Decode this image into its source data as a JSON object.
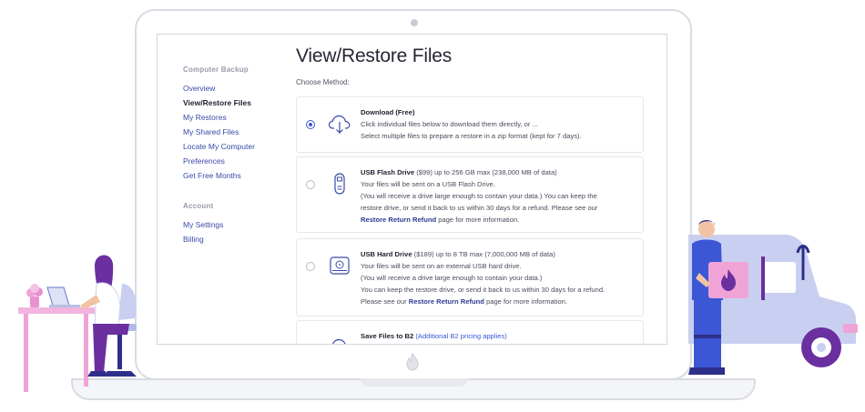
{
  "sidebar": {
    "section_backup": "Computer Backup",
    "backup_items": [
      "Overview",
      "View/Restore Files",
      "My Restores",
      "My Shared Files",
      "Locate My Computer",
      "Preferences",
      "Get Free Months"
    ],
    "active_index": 1,
    "section_account": "Account",
    "account_items": [
      "My Settings",
      "Billing"
    ]
  },
  "main": {
    "title": "View/Restore Files",
    "choose_label": "Choose Method:"
  },
  "methods": {
    "download": {
      "icon": "cloud-download-icon",
      "title": "Download (Free)",
      "line1": "Click individual files below to download them directly, or ...",
      "line2": "Select multiple files to prepare a restore in a zip format (kept for 7 days)."
    },
    "usb_flash": {
      "icon": "usb-flash-drive-icon",
      "title": "USB Flash Drive",
      "price": " ($99) up to 256 GB max (238,000 MB of data)",
      "line1": "Your files will be sent on a USB Flash Drive.",
      "line2": "(You will receive a drive large enough to contain your data.) You can keep the",
      "line3": "restore drive, or send it back to us within 30 days for a refund. Please see our",
      "link": "Restore Return Refund",
      "after_link": " page for more information."
    },
    "usb_hdd": {
      "icon": "hard-drive-icon",
      "title": "USB Hard Drive",
      "price": " ($189) up to 8 TB max (7,000,000 MB of data)",
      "line1": "Your files will be sent on an external USB hard drive.",
      "line2": "(You will receive a drive large enough to contain your data.)",
      "line3": "You can keep the restore drive, or send it back to us within 30 days for a refund.",
      "before_link": "Please see our ",
      "link": "Restore Return Refund",
      "after_link": " page for more information."
    },
    "b2": {
      "icon": "cloud-upload-icon",
      "title": "Save Files to B2",
      "extra": " (Additional B2 pricing applies)"
    }
  },
  "colors": {
    "accent": "#3b57d6",
    "link": "#3a4aa8",
    "illustration_purple": "#6b2fa0",
    "illustration_pink": "#f0a3d6",
    "van_lavender": "#c9cff0"
  }
}
